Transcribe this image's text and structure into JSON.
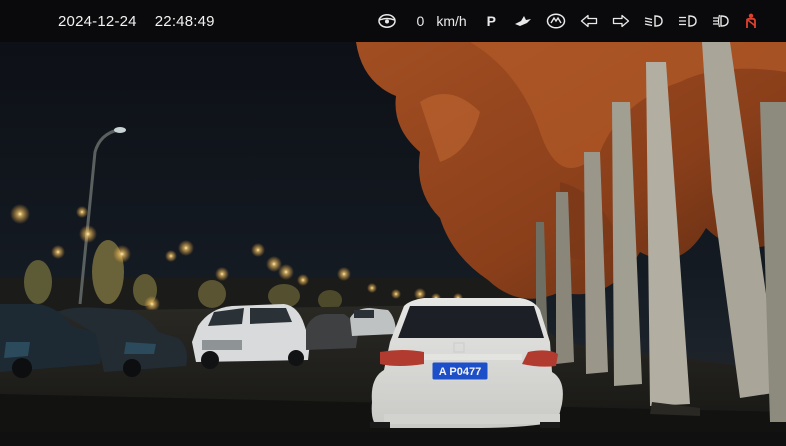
{
  "status_bar": {
    "date": "2024-12-24",
    "time": "22:48:49",
    "speed_value": "0",
    "speed_unit": "km/h",
    "gear": "P",
    "icons": [
      "steering-wheel-icon",
      "ahead-bird-icon",
      "brand-badge-icon",
      "turn-left-icon",
      "turn-right-icon",
      "low-beam-icon",
      "position-light-icon",
      "fog-light-icon",
      "seatbelt-warning-icon"
    ],
    "colors": {
      "bar": "#0a0a0c",
      "text": "#f2f2f2",
      "warning": "#e0412e"
    }
  },
  "camera_view": {
    "plate_text": "A P0477",
    "colors": {
      "sky": "#0e1218",
      "foliage": "#9a4a22",
      "plate": "#1d4fc9",
      "car": "#f1f1ef",
      "lamps": "#ffd27a"
    }
  }
}
